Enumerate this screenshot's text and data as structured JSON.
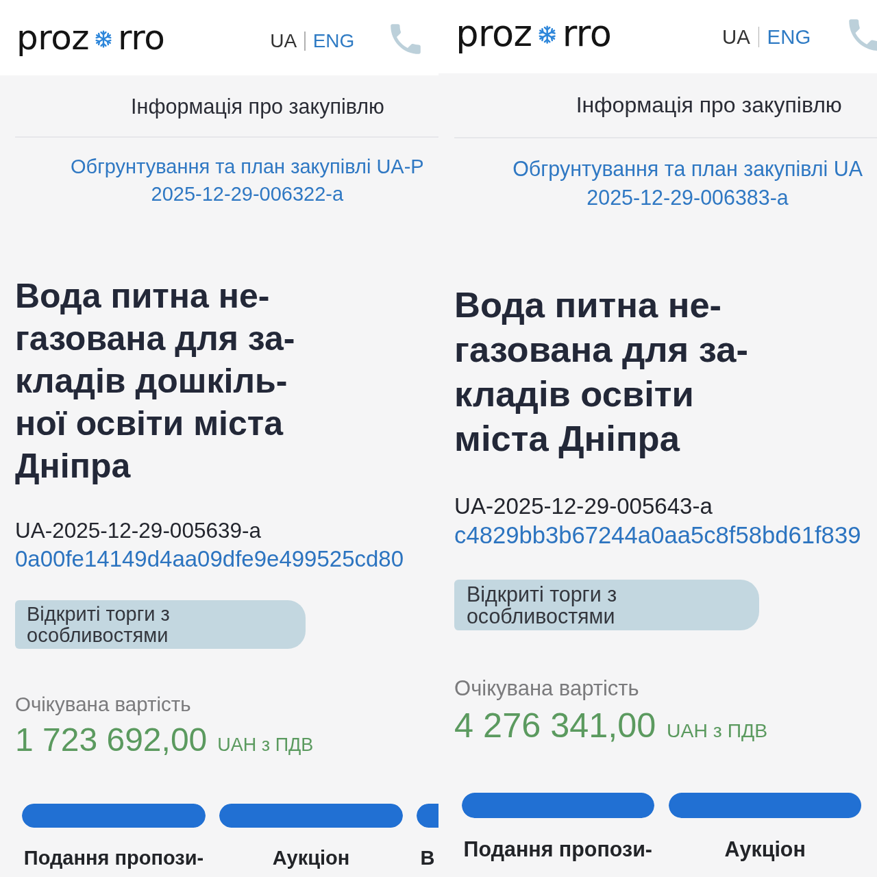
{
  "panels": [
    {
      "header": {
        "logo": [
          "proz",
          "rro"
        ],
        "languages": [
          {
            "label": "UA",
            "selected": true
          },
          {
            "label": "ENG",
            "selected": false
          }
        ]
      },
      "section_title": "Інформація про закупівлю",
      "plan_link": [
        "Обгрунтування та план закупівлі UA-P",
        "2025-12-29-006322-a"
      ],
      "title": [
        "Вода питна не-",
        "газована для за-",
        "кладів дошкіль-",
        "ної освіти міста",
        "Дніпра"
      ],
      "tender_id": "UA-2025-12-29-005639-a",
      "tender_hash": "0a00fe14149d4aa09dfe9e499525cd80",
      "procedure_type": "Відкриті торги з особливостями",
      "expected_value": {
        "label": "Очікувана вартість",
        "amount": "1 723 692,00",
        "currency": "UAH з ПДВ"
      },
      "stages": [
        {
          "label": "Подання пропози-"
        },
        {
          "label": "Аукціон"
        },
        {
          "label": "В"
        }
      ]
    },
    {
      "header": {
        "logo": [
          "proz",
          "rro"
        ],
        "languages": [
          {
            "label": "UA",
            "selected": true
          },
          {
            "label": "ENG",
            "selected": false
          }
        ]
      },
      "section_title": "Інформація про закупівлю",
      "plan_link": [
        "Обгрунтування та план закупівлі UA",
        "2025-12-29-006383-a"
      ],
      "title": [
        "Вода питна не-",
        "газована для за-",
        "кладів освіти",
        "міста Дніпра"
      ],
      "tender_id": "UA-2025-12-29-005643-a",
      "tender_hash": "c4829bb3b67244a0aa5c8f58bd61f839",
      "procedure_type": "Відкриті торги з особливостями",
      "expected_value": {
        "label": "Очікувана вартість",
        "amount": "4 276 341,00",
        "currency": "UAH з ПДВ"
      },
      "stages": [
        {
          "label": "Подання пропози-"
        },
        {
          "label": "Аукціон"
        }
      ]
    }
  ]
}
